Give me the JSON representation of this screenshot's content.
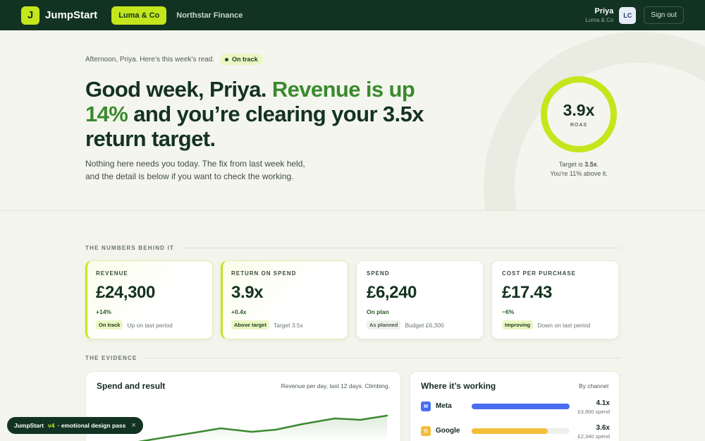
{
  "header": {
    "logo_letter": "J",
    "brand": "JumpStart",
    "clients": [
      {
        "label": "Luma & Co",
        "active": true
      },
      {
        "label": "Northstar Finance",
        "active": false
      }
    ],
    "user_name": "Priya",
    "user_company": "Luma & Co",
    "avatar_initials": "LC",
    "signout_label": "Sign out"
  },
  "hero": {
    "greeting": "Afternoon, Priya. Here’s this week’s read.",
    "status_pill": "On track",
    "headline_part1": "Good week, Priya. ",
    "headline_highlight": "Revenue is up 14%",
    "headline_part2": " and you’re clearing your 3.5x return target.",
    "subline": "Nothing here needs you today. The fix from last week held, and the detail is below if you want to check the working.",
    "roas_value": "3.9x",
    "roas_label": "ROAS",
    "target_prefix": "Target is ",
    "target_value": "3.5x",
    "target_suffix": ".",
    "target_line2": "You’re 11% above it."
  },
  "sections": {
    "numbers_label": "THE NUMBERS BEHIND IT",
    "evidence_label": "THE EVIDENCE"
  },
  "kpis": [
    {
      "label": "REVENUE",
      "value": "£24,300",
      "delta": "+14%",
      "tag": "On track",
      "note": "Up on last period"
    },
    {
      "label": "RETURN ON SPEND",
      "value": "3.9x",
      "delta": "+0.4x",
      "tag": "Above target",
      "note": "Target 3.5x"
    },
    {
      "label": "SPEND",
      "value": "£6,240",
      "delta": "On plan",
      "tag": "As planned",
      "note": "Budget £6,300"
    },
    {
      "label": "COST PER PURCHASE",
      "value": "£17.43",
      "delta": "−6%",
      "tag": "Improving",
      "note": "Down on last period"
    }
  ],
  "spend_panel": {
    "title": "Spend and result",
    "subtitle": "Revenue per day, last 12 days. Climbing.",
    "line_color": "#3a8a2f"
  },
  "channel_panel": {
    "title": "Where it’s working",
    "subtitle": "By channel",
    "channels": [
      {
        "icon_letter": "M",
        "name": "Meta",
        "roas": "4.1x",
        "spend": "£3,900 spend",
        "fill": 1.0,
        "color": "#4a6ef0"
      },
      {
        "icon_letter": "G",
        "name": "Google",
        "roas": "3.6x",
        "spend": "£2,340 spend",
        "fill": 0.78,
        "color": "#f5bd3a"
      }
    ]
  },
  "toast": {
    "brand": "JumpStart",
    "version": "v4",
    "text": "· emotional design pass",
    "close_icon": "×"
  }
}
